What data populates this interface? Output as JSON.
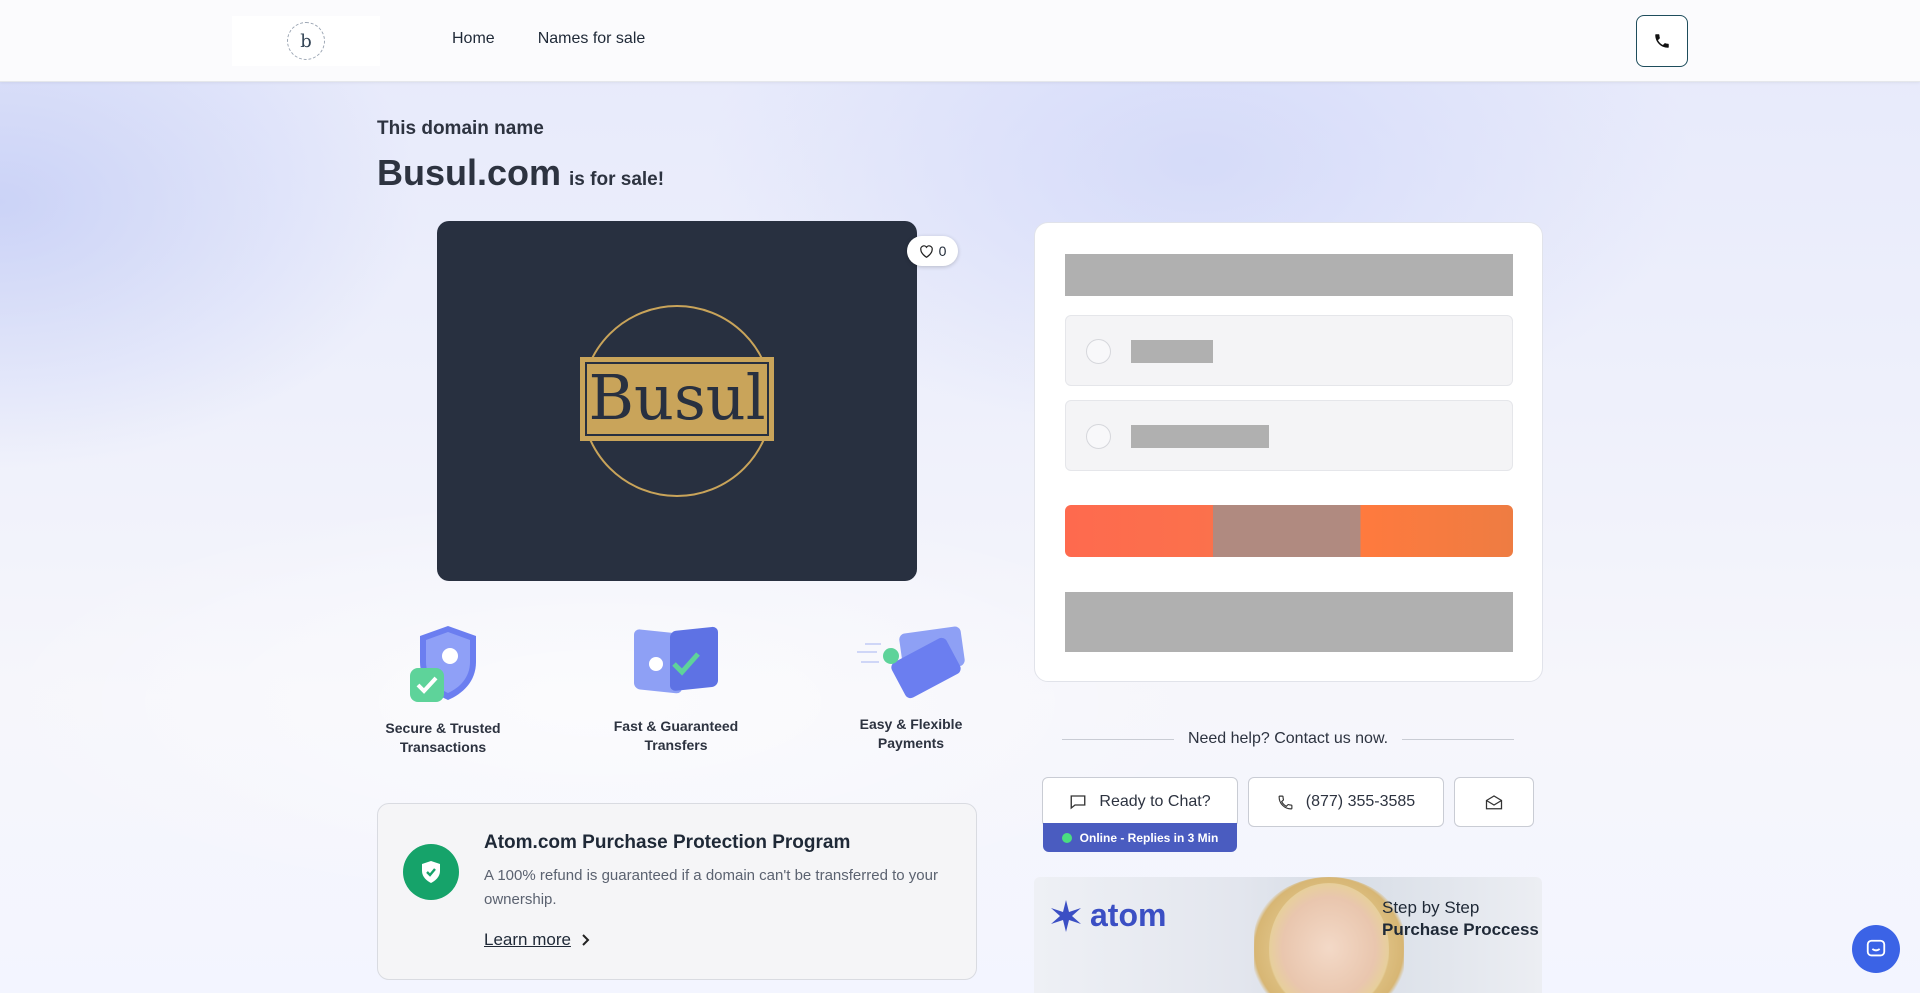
{
  "header": {
    "nav": [
      {
        "label": "Home"
      },
      {
        "label": "Names for sale"
      }
    ]
  },
  "hero": {
    "subtitle": "This domain name",
    "domain": "Busul.com",
    "suffix": "is for sale!",
    "logo_text": "Busul",
    "likes": "0"
  },
  "features": [
    {
      "label_line1": "Secure & Trusted",
      "label_line2": "Transactions",
      "icon": "shield-check-icon"
    },
    {
      "label_line1": "Fast & Guaranteed",
      "label_line2": "Transfers",
      "icon": "transfer-icon"
    },
    {
      "label_line1": "Easy & Flexible",
      "label_line2": "Payments",
      "icon": "credit-card-icon"
    }
  ],
  "protection": {
    "title": "Atom.com Purchase Protection Program",
    "text": "A 100% refund is guaranteed if a domain can't be transferred to your ownership.",
    "link": "Learn more"
  },
  "help": {
    "label": "Need help? Contact us now.",
    "chat_label": "Ready to Chat?",
    "phone_label": "(877) 355-3585",
    "online_label": "Online - Replies in 3 Min"
  },
  "banner": {
    "brand": "atom",
    "line1": "Step by Step",
    "line2": "Purchase Proccess"
  },
  "colors": {
    "accent": "#3b4fc4",
    "cta_left": "#fe6a4e",
    "cta_right": "#ee7c42",
    "success": "#16a36a",
    "card_dark": "#283040",
    "logo_gold": "#c9a45a"
  }
}
